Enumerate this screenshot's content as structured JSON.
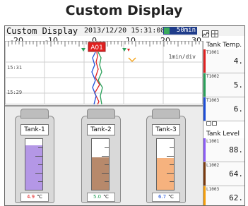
{
  "page_title": "Custom Display",
  "statusbar": {
    "app_title": "Custom Display",
    "datetime": "2013/12/20 15:31:08",
    "speed_value": "50min",
    "icons": [
      "media-icon",
      "trend-mode-icon",
      "grid-layout-icon"
    ]
  },
  "trend": {
    "scale_labels": [
      "-20",
      "-10",
      "0",
      "10",
      "20",
      "30"
    ],
    "alarm_tag": "A01",
    "rate_label": "1min/div",
    "time_labels": [
      "15:31",
      "15:29"
    ],
    "trace_colors": [
      "#e02020",
      "#2aa05a",
      "#1d4ed8"
    ]
  },
  "tank_temp": {
    "title": "Tank Temp.",
    "tiles": [
      {
        "tag": "T1001",
        "value": "4.",
        "color": "#e02020"
      },
      {
        "tag": "T1002",
        "value": "5.",
        "color": "#2aa05a"
      },
      {
        "tag": "T1003",
        "value": "6.",
        "color": "#1d4ed8"
      }
    ]
  },
  "tank_level": {
    "title": "Tank Level",
    "tiles": [
      {
        "tag": "L1001",
        "value": "88.",
        "color": "#8b5cf6"
      },
      {
        "tag": "L1002",
        "value": "64.",
        "color": "#7a3b10"
      },
      {
        "tag": "L1003",
        "value": "62.",
        "color": "#f59e0b"
      }
    ]
  },
  "tanks": [
    {
      "label": "Tank-1",
      "temp_value": "4.9",
      "temp_unit": "℃",
      "value_color": "#e02020",
      "fill_color": "#b497e6",
      "level": 0.88
    },
    {
      "label": "Tank-2",
      "temp_value": "5.0",
      "temp_unit": "℃",
      "value_color": "#2aa05a",
      "fill_color": "#b7896b",
      "level": 0.64
    },
    {
      "label": "Tank-3",
      "temp_value": "6.7",
      "temp_unit": "℃",
      "value_color": "#1d4ed8",
      "fill_color": "#f6b27e",
      "level": 0.62
    }
  ]
}
